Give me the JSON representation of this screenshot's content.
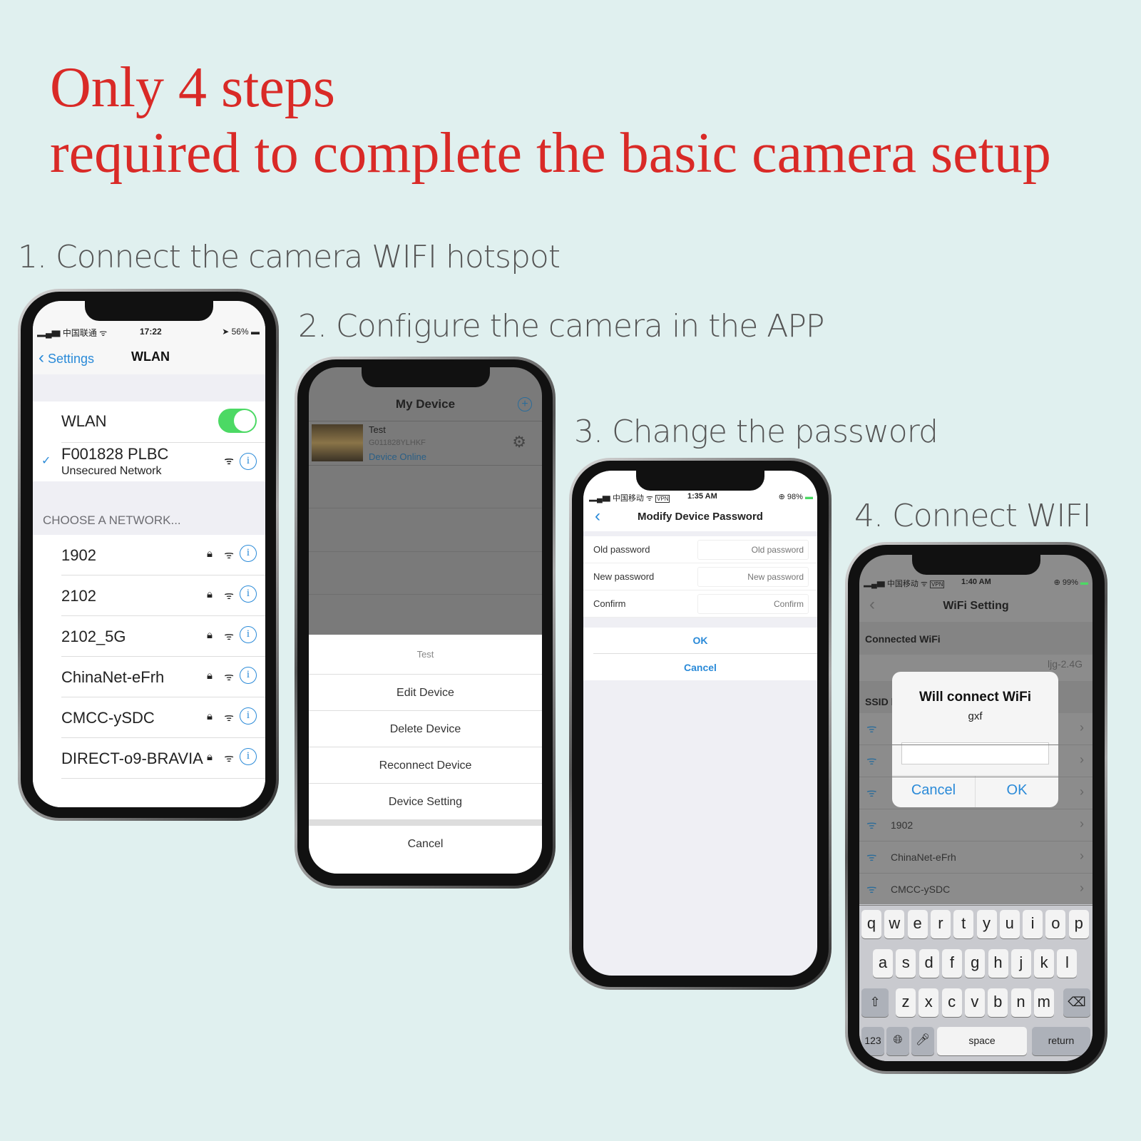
{
  "headline": {
    "line1": "Only 4 steps",
    "line2": "required to complete the basic camera setup"
  },
  "steps": [
    "1. Connect the camera WIFI hotspot",
    "2. Configure the camera in the APP",
    "3. Change the password",
    "4. Connect WIFI"
  ],
  "colors": {
    "headline": "#d92a27",
    "ios_blue": "#2a8ad8",
    "toggle_green": "#4cd964",
    "background": "#e0f0ef"
  },
  "phone1": {
    "status": {
      "carrier": "中国联通",
      "time": "17:22",
      "battery": "56%"
    },
    "back": "Settings",
    "title": "WLAN",
    "wlan_label": "WLAN",
    "wlan_on": true,
    "current": {
      "name": "F001828 PLBC",
      "sub": "Unsecured Network"
    },
    "section": "CHOOSE A NETWORK...",
    "networks": [
      "1902",
      "2102",
      "2102_5G",
      "ChinaNet-eFrh",
      "CMCC-ySDC",
      "DIRECT-o9-BRAVIA"
    ]
  },
  "phone2": {
    "title": "My Device",
    "device": {
      "name": "Test",
      "id": "G011828YLHKF",
      "status": "Device Online"
    },
    "sheet_title": "Test",
    "actions": [
      "Edit Device",
      "Delete Device",
      "Reconnect Device",
      "Device Setting"
    ],
    "cancel": "Cancel"
  },
  "phone3": {
    "status": {
      "carrier": "中国移动",
      "vpn": "VPN",
      "time": "1:35 AM",
      "battery": "98%"
    },
    "title": "Modify Device Password",
    "fields": [
      {
        "label": "Old password",
        "placeholder": "Old password"
      },
      {
        "label": "New password",
        "placeholder": "New password"
      },
      {
        "label": "Confirm",
        "placeholder": "Confirm"
      }
    ],
    "ok": "OK",
    "cancel": "Cancel"
  },
  "phone4": {
    "status": {
      "carrier": "中国移动",
      "vpn": "VPN",
      "time": "1:40 AM",
      "battery": "99%"
    },
    "title": "WiFi Setting",
    "connected_header": "Connected WiFi",
    "connected_value": "ljg-2.4G",
    "ssid_header": "SSID list",
    "ssids": [
      "",
      "",
      "",
      "1902",
      "ChinaNet-eFrh",
      "CMCC-ySDC"
    ],
    "dialog": {
      "title": "Will connect WiFi",
      "ssid": "gxf",
      "input": "",
      "cancel": "Cancel",
      "ok": "OK"
    },
    "keyboard": {
      "row1": [
        "q",
        "w",
        "e",
        "r",
        "t",
        "y",
        "u",
        "i",
        "o",
        "p"
      ],
      "row2": [
        "a",
        "s",
        "d",
        "f",
        "g",
        "h",
        "j",
        "k",
        "l"
      ],
      "row3": [
        "z",
        "x",
        "c",
        "v",
        "b",
        "n",
        "m"
      ],
      "num": "123",
      "space": "space",
      "return": "return"
    }
  }
}
